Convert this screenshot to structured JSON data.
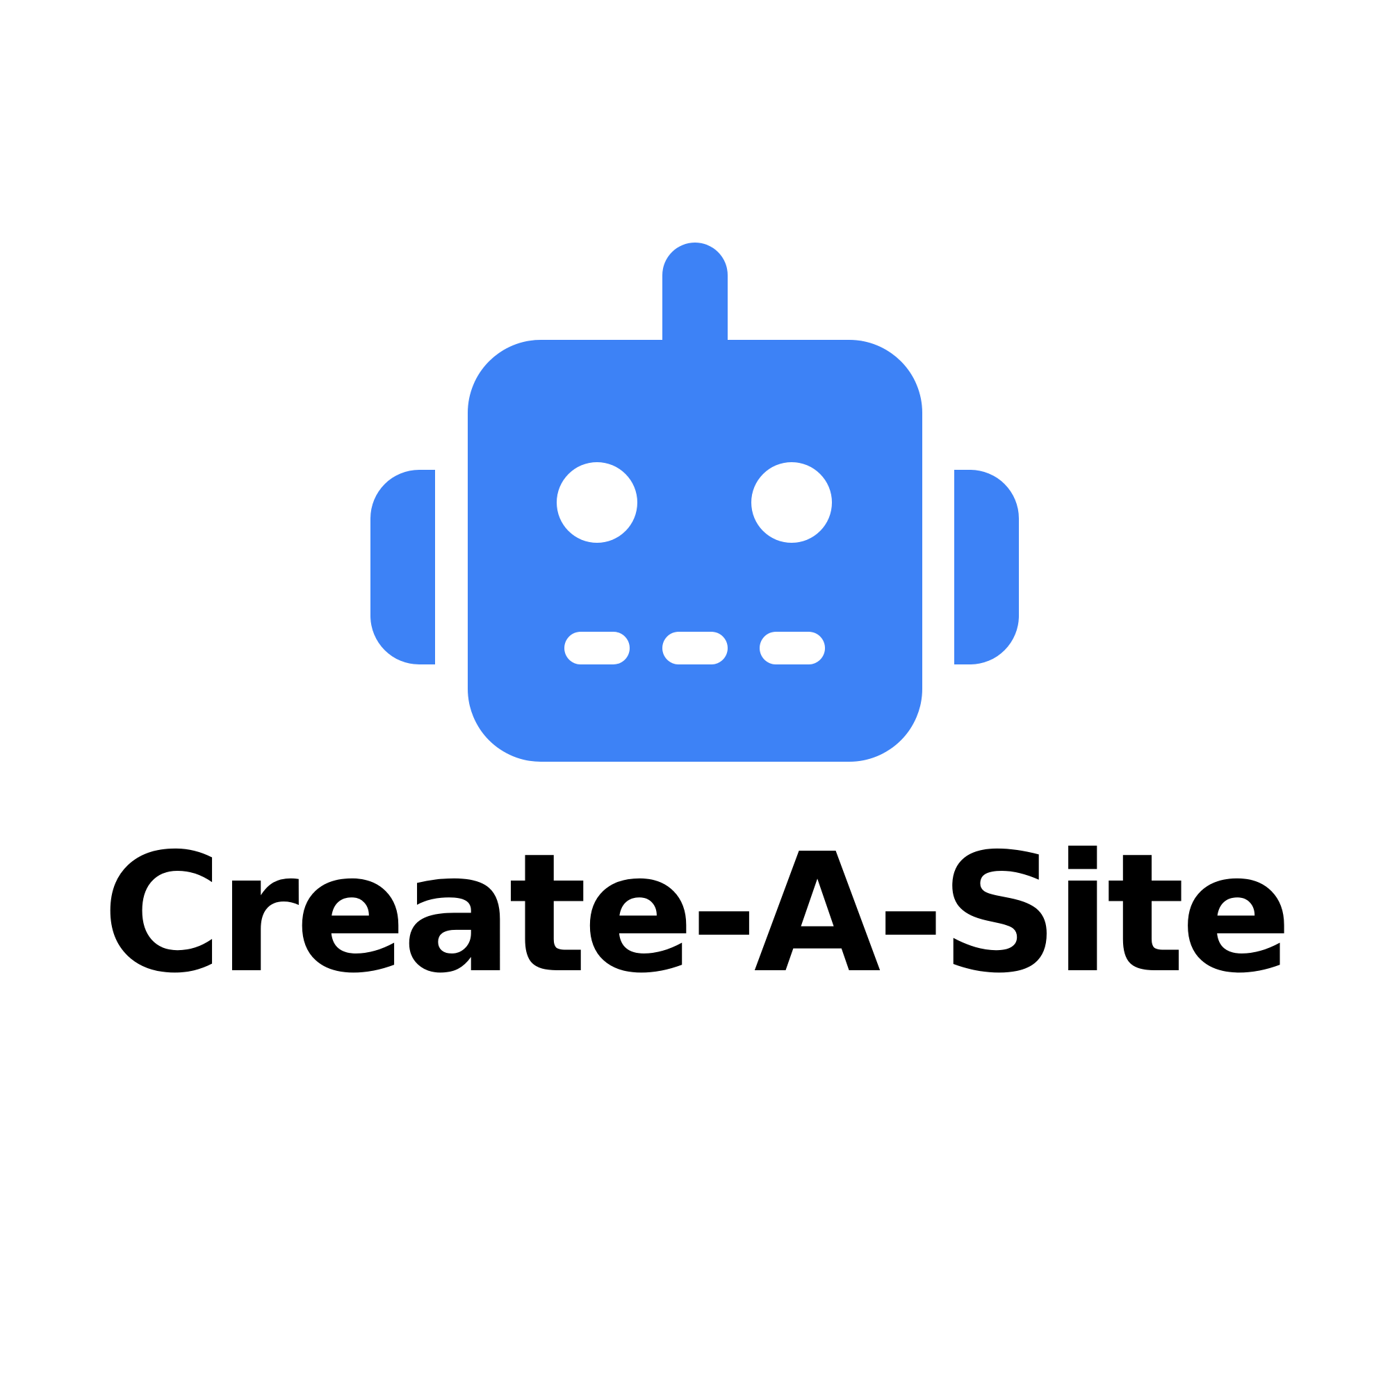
{
  "brand": {
    "name": "Create-A-Site",
    "accent_color": "#3d82f6",
    "text_color": "#000000",
    "background_color": "#ffffff"
  },
  "logo": {
    "icon": "robot-head-icon"
  }
}
